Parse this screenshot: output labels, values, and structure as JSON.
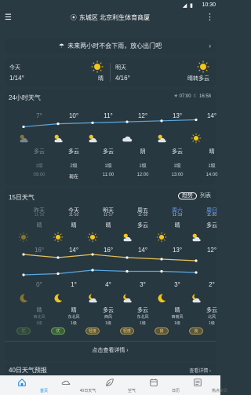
{
  "status_bar": {
    "time": "10:30",
    "left": "≡ ⊕"
  },
  "header": {
    "location": "东城区 北京利生体育商厦"
  },
  "alert": {
    "text": "未来两小时不会下雨，放心出门吧"
  },
  "today": {
    "label": "今天",
    "temp": "1/14°",
    "condition": "晴"
  },
  "tomorrow": {
    "label": "明天",
    "temp": "4/16°",
    "condition": "晴转多云"
  },
  "hourly": {
    "title": "24小时天气",
    "sunrise": "07:00",
    "sunset": "16:58",
    "hours": [
      {
        "temp": "7°",
        "cond": "多云",
        "wind": "1级",
        "time": "09:00",
        "icon": "cloud-sun"
      },
      {
        "temp": "10°",
        "cond": "多云",
        "wind": "2级",
        "time": "现在",
        "icon": "cloud-sun"
      },
      {
        "temp": "11°",
        "cond": "多云",
        "wind": "1级",
        "time": "11:00",
        "icon": "cloud-sun"
      },
      {
        "temp": "12°",
        "cond": "阴",
        "wind": "1级",
        "time": "12:00",
        "icon": "cloud"
      },
      {
        "temp": "13°",
        "cond": "多云",
        "wind": "1级",
        "time": "13:00",
        "icon": "cloud-sun"
      },
      {
        "temp": "14°",
        "cond": "晴",
        "wind": "1级",
        "time": "14:00",
        "icon": "sun"
      }
    ]
  },
  "daily": {
    "title": "15日天气",
    "toggle_on": "趋势",
    "toggle_off": "列表",
    "more": "点击查看详情 ›",
    "days": [
      {
        "day": "昨天",
        "date": "11-15",
        "cond": "晴",
        "hi": "16°",
        "lo": "0°",
        "night": "晴",
        "wind": "西北风",
        "level": "1级",
        "aq": "优",
        "aq_class": "good"
      },
      {
        "day": "今天",
        "date": "11-16",
        "cond": "晴",
        "hi": "14°",
        "lo": "1°",
        "night": "晴",
        "wind": "东北风",
        "level": "1级",
        "aq": "优",
        "aq_class": "good"
      },
      {
        "day": "明天",
        "date": "11-17",
        "cond": "晴",
        "hi": "16°",
        "lo": "4°",
        "night": "多云",
        "wind": "西风",
        "level": "1级",
        "aq": "轻度",
        "aq_class": "mild"
      },
      {
        "day": "周五",
        "date": "11-18",
        "cond": "多云",
        "hi": "14°",
        "lo": "3°",
        "night": "多云",
        "wind": "东北风",
        "level": "1级",
        "aq": "轻度",
        "aq_class": "mild"
      },
      {
        "day": "周六",
        "date": "11-19",
        "cond": "晴",
        "hi": "13°",
        "lo": "3°",
        "night": "晴",
        "wind": "西南风",
        "level": "1级",
        "aq": "良",
        "aq_class": "mild"
      },
      {
        "day": "周日",
        "date": "11-20",
        "cond": "多云",
        "hi": "12°",
        "lo": "2°",
        "night": "多云",
        "wind": "北风",
        "level": "1级",
        "aq": "良",
        "aq_class": "mild"
      }
    ]
  },
  "forty": {
    "title": "40日天气预报",
    "link": "查看详情 ›"
  },
  "nav": [
    {
      "label": "首页",
      "icon": "home-icon"
    },
    {
      "label": "40日天气",
      "icon": "calendar-cloud-icon"
    },
    {
      "label": "空气",
      "icon": "leaf-icon"
    },
    {
      "label": "日历",
      "icon": "calendar-icon"
    },
    {
      "label": "热点资讯",
      "icon": "news-icon"
    }
  ],
  "colors": {
    "accent": "#1a8be8",
    "sun": "#f5c518",
    "hi_line": "#e8c25a",
    "lo_line": "#5aa8e0"
  }
}
